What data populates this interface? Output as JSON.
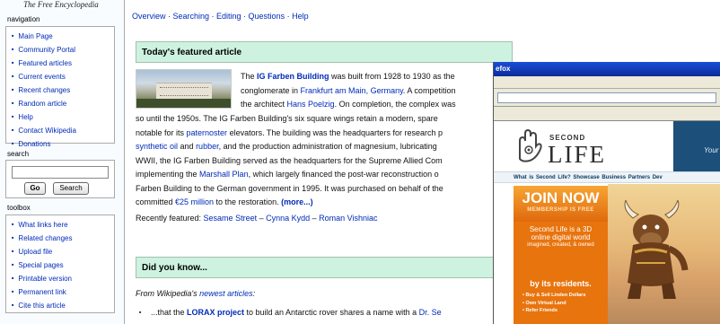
{
  "sidebar": {
    "tagline": "The Free Encyclopedia",
    "navigation": {
      "title": "navigation",
      "items": [
        "Main Page",
        "Community Portal",
        "Featured articles",
        "Current events",
        "Recent changes",
        "Random article",
        "Help",
        "Contact Wikipedia",
        "Donations"
      ]
    },
    "search": {
      "title": "search",
      "input_value": "",
      "go_label": "Go",
      "search_label": "Search"
    },
    "toolbox": {
      "title": "toolbox",
      "items": [
        "What links here",
        "Related changes",
        "Upload file",
        "Special pages",
        "Printable version",
        "Permanent link",
        "Cite this article"
      ]
    }
  },
  "main": {
    "topnav": "Overview · Searching · Editing · Questions · Help",
    "featured": {
      "heading": "Today's featured article",
      "line1_pre": "The ",
      "line1_link": "IG Farben Building",
      "line1_post": " was built from 1928 to 1930 as the",
      "line2_pre": "conglomerate in ",
      "line2_link": "Frankfurt am Main, Germany",
      "line2_post": ". A competition",
      "line3_pre": "the architect ",
      "line3_link": "Hans Poelzig",
      "line3_post": ". On completion, the complex was",
      "line4": "so until the 1950s. The IG Farben Building's six square wings retain a modern, spare",
      "line5_pre": "notable for its ",
      "line5_link": "paternoster",
      "line5_post": " elevators. The building was the headquarters for research p",
      "line6_link1": "synthetic oil",
      "line6_mid": " and ",
      "line6_link2": "rubber",
      "line6_post": ", and the production administration of magnesium, lubricating",
      "line7": "WWII, the IG Farben Building served as the headquarters for the Supreme Allied Com",
      "line8_pre": "implementing the ",
      "line8_link": "Marshall Plan",
      "line8_post": ", which largely financed the post-war reconstruction o",
      "line9": "Farben Building to the German government in 1995. It was purchased on behalf of the",
      "line10_pre": "committed ",
      "line10_link": "€25 million",
      "line10_post": " to the restoration. ",
      "more": "(more...)",
      "recent_label": "Recently featured: ",
      "recent_1": "Sesame Street",
      "recent_sep1": " – ",
      "recent_2": "Cynna Kydd",
      "recent_sep2": " – ",
      "recent_3": "Roman Vishniac"
    },
    "dyk": {
      "heading": "Did you know...",
      "intro_pre": "From Wikipedia's ",
      "intro_link": "newest articles",
      "intro_post": ":",
      "item_pre": "...that the ",
      "item_link": "LORAX project",
      "item_post": " to build an Antarctic rover shares a name with a ",
      "item_link2": "Dr. Se"
    }
  },
  "firefox": {
    "title": "efox"
  },
  "secondlife": {
    "logo_second": "SECOND",
    "logo_life": "LIFE",
    "logo_tm": "®",
    "tagline": "Your Wo",
    "nav": "What is Second Life?   Showcase   Business Partners   Dev",
    "join_main": "JOIN NOW",
    "join_sub": "MEMBERSHIP IS FREE",
    "desc_line1": "Second Life is a 3D",
    "desc_line2": "online digital world",
    "desc_small": "imagined, created, & owned",
    "residents": "by its residents.",
    "features": [
      "• Buy & Sell Linden Dollars",
      "• Own Virtual Land",
      "• Refer Friends"
    ]
  },
  "colors": {
    "link": "#002bb8",
    "box_head_bg": "#cef2e0",
    "promo_orange": "#e8740e",
    "titlebar_blue": "#1b4ed8"
  }
}
